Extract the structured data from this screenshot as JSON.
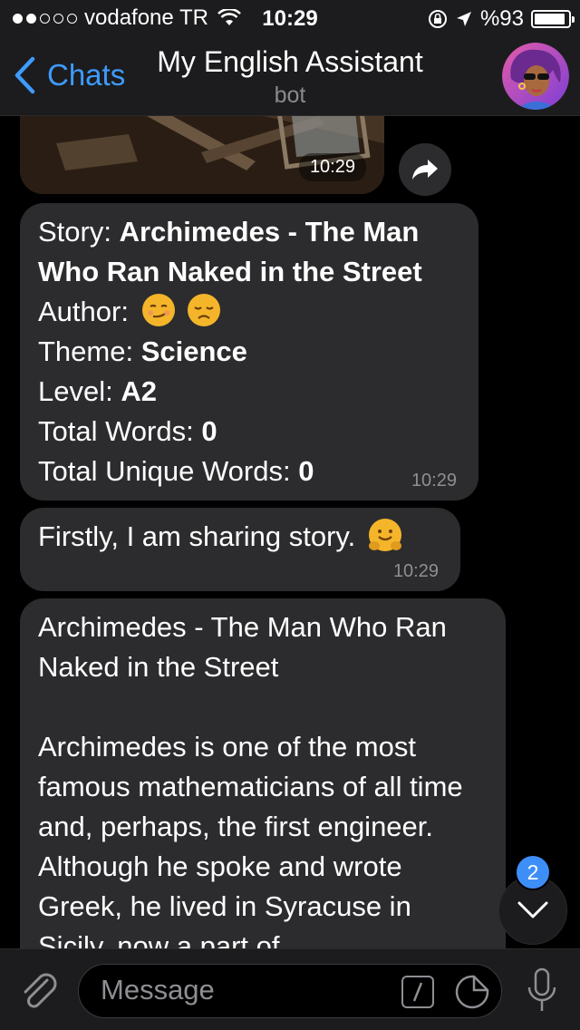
{
  "status": {
    "carrier": "vodafone TR",
    "time": "10:29",
    "battery_text": "%93",
    "battery_level": 0.93
  },
  "nav": {
    "back_label": "Chats",
    "title": "My English Assistant",
    "subtitle": "bot"
  },
  "media": {
    "time": "10:29"
  },
  "messages": {
    "info": {
      "story_label": "Story: ",
      "story_value": "Archimedes - The Man Who Ran Naked in the Street",
      "author_label": "Author:",
      "theme_label": "Theme: ",
      "theme_value": "Science",
      "level_label": "Level: ",
      "level_value": "A2",
      "total_words_label": "Total Words: ",
      "total_words_value": "0",
      "unique_words_label": "Total Unique Words: ",
      "unique_words_value": "0",
      "time": "10:29"
    },
    "sharing": {
      "text": "Firstly, I am sharing story.",
      "time": "10:29"
    },
    "story": {
      "title": "Archimedes - The Man Who Ran Naked in the Street",
      "body": "Archimedes is one of the most famous mathematicians of all time and, perhaps, the first engineer. Although he spoke and wrote Greek, he lived in Syracuse in Sicily, now a part of"
    }
  },
  "scroll": {
    "badge_count": "2"
  },
  "input": {
    "placeholder": "Message"
  },
  "icons": {
    "accent": "#3e9bff",
    "badge_color": "#3e8ef7"
  }
}
